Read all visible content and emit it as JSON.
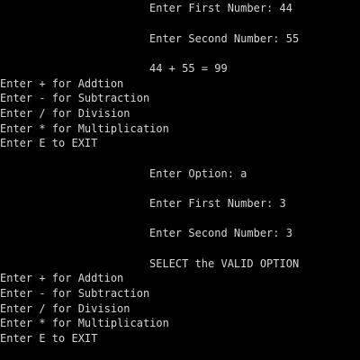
{
  "console": {
    "lines": [
      "Enter First Number: 44",
      "Enter Second Number: 55",
      "44 + 55 = 99",
      "Enter + for Addtion",
      "Enter - for Subtraction",
      "Enter / for Division",
      "Enter * for Multiplication",
      "Enter E to EXIT",
      "Enter Option: a",
      "Enter First Number: 3",
      "Enter Second Number: 3",
      "SELECT the VALID OPTION",
      "Enter + for Addtion",
      "Enter - for Subtraction",
      "Enter / for Division",
      "Enter * for Multiplication",
      "Enter E to EXIT"
    ]
  },
  "colors": {
    "background": "#000000",
    "text": "#d6d6d6"
  }
}
